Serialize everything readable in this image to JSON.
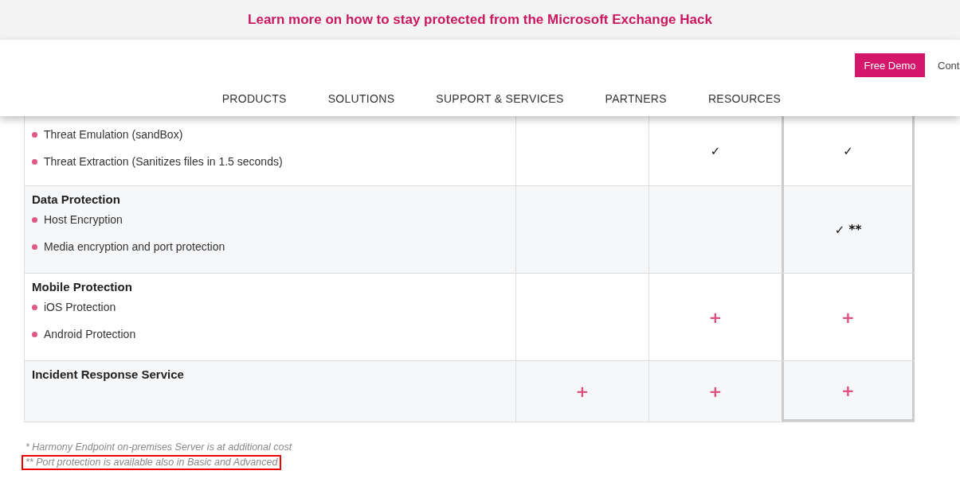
{
  "banner": {
    "link": "Learn more on how to stay protected from the Microsoft Exchange Hack"
  },
  "header": {
    "demo_button": "Free Demo",
    "cut_link": "Cont",
    "nav": [
      "PRODUCTS",
      "SOLUTIONS",
      "SUPPORT & SERVICES",
      "PARTNERS",
      "RESOURCES"
    ]
  },
  "table": {
    "rows": [
      {
        "title": null,
        "features": [
          "Threat Emulation (sandBox)",
          "Threat Extraction (Sanitizes files in 1.5 seconds)"
        ],
        "cells": [
          {
            "kind": "empty"
          },
          {
            "kind": "check",
            "text": "✓"
          },
          {
            "kind": "check",
            "text": "✓"
          }
        ]
      },
      {
        "title": "Data Protection",
        "features": [
          "Host Encryption",
          "Media encryption and port protection"
        ],
        "cells": [
          {
            "kind": "empty"
          },
          {
            "kind": "empty"
          },
          {
            "kind": "check",
            "text": "✓ **"
          }
        ]
      },
      {
        "title": "Mobile Protection",
        "features": [
          "iOS Protection",
          "Android Protection"
        ],
        "cells": [
          {
            "kind": "empty"
          },
          {
            "kind": "plus",
            "text": "+"
          },
          {
            "kind": "plus",
            "text": "+"
          }
        ]
      },
      {
        "title": "Incident Response Service",
        "features": [],
        "cells": [
          {
            "kind": "plus",
            "text": "+"
          },
          {
            "kind": "plus",
            "text": "+"
          },
          {
            "kind": "plus",
            "text": "+"
          }
        ]
      }
    ]
  },
  "footnotes": [
    {
      "text": "* Harmony Endpoint on-premises Server is at additional cost",
      "highlighted": false
    },
    {
      "text": "** Port protection is available also in Basic and Advanced",
      "highlighted": true
    }
  ]
}
